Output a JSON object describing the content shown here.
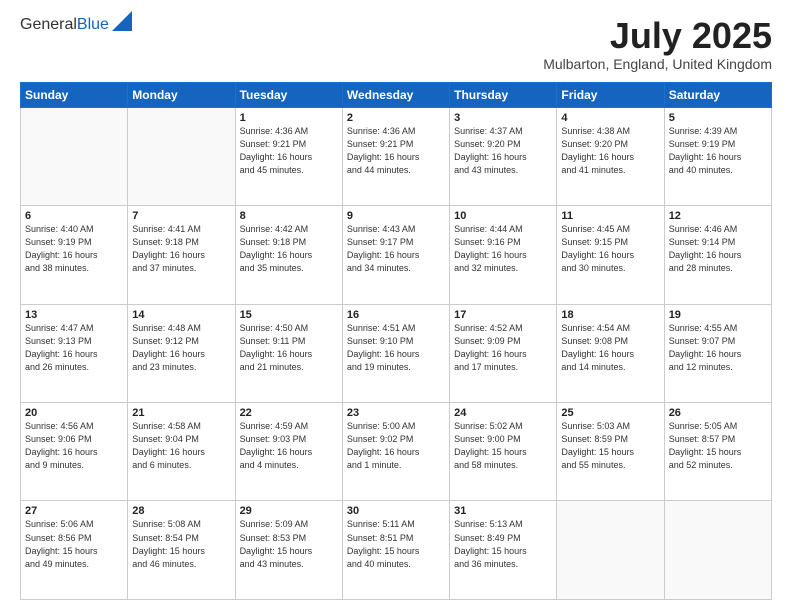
{
  "logo": {
    "general": "General",
    "blue": "Blue"
  },
  "header": {
    "title": "July 2025",
    "location": "Mulbarton, England, United Kingdom"
  },
  "days_of_week": [
    "Sunday",
    "Monday",
    "Tuesday",
    "Wednesday",
    "Thursday",
    "Friday",
    "Saturday"
  ],
  "weeks": [
    [
      {
        "day": "",
        "info": ""
      },
      {
        "day": "",
        "info": ""
      },
      {
        "day": "1",
        "info": "Sunrise: 4:36 AM\nSunset: 9:21 PM\nDaylight: 16 hours\nand 45 minutes."
      },
      {
        "day": "2",
        "info": "Sunrise: 4:36 AM\nSunset: 9:21 PM\nDaylight: 16 hours\nand 44 minutes."
      },
      {
        "day": "3",
        "info": "Sunrise: 4:37 AM\nSunset: 9:20 PM\nDaylight: 16 hours\nand 43 minutes."
      },
      {
        "day": "4",
        "info": "Sunrise: 4:38 AM\nSunset: 9:20 PM\nDaylight: 16 hours\nand 41 minutes."
      },
      {
        "day": "5",
        "info": "Sunrise: 4:39 AM\nSunset: 9:19 PM\nDaylight: 16 hours\nand 40 minutes."
      }
    ],
    [
      {
        "day": "6",
        "info": "Sunrise: 4:40 AM\nSunset: 9:19 PM\nDaylight: 16 hours\nand 38 minutes."
      },
      {
        "day": "7",
        "info": "Sunrise: 4:41 AM\nSunset: 9:18 PM\nDaylight: 16 hours\nand 37 minutes."
      },
      {
        "day": "8",
        "info": "Sunrise: 4:42 AM\nSunset: 9:18 PM\nDaylight: 16 hours\nand 35 minutes."
      },
      {
        "day": "9",
        "info": "Sunrise: 4:43 AM\nSunset: 9:17 PM\nDaylight: 16 hours\nand 34 minutes."
      },
      {
        "day": "10",
        "info": "Sunrise: 4:44 AM\nSunset: 9:16 PM\nDaylight: 16 hours\nand 32 minutes."
      },
      {
        "day": "11",
        "info": "Sunrise: 4:45 AM\nSunset: 9:15 PM\nDaylight: 16 hours\nand 30 minutes."
      },
      {
        "day": "12",
        "info": "Sunrise: 4:46 AM\nSunset: 9:14 PM\nDaylight: 16 hours\nand 28 minutes."
      }
    ],
    [
      {
        "day": "13",
        "info": "Sunrise: 4:47 AM\nSunset: 9:13 PM\nDaylight: 16 hours\nand 26 minutes."
      },
      {
        "day": "14",
        "info": "Sunrise: 4:48 AM\nSunset: 9:12 PM\nDaylight: 16 hours\nand 23 minutes."
      },
      {
        "day": "15",
        "info": "Sunrise: 4:50 AM\nSunset: 9:11 PM\nDaylight: 16 hours\nand 21 minutes."
      },
      {
        "day": "16",
        "info": "Sunrise: 4:51 AM\nSunset: 9:10 PM\nDaylight: 16 hours\nand 19 minutes."
      },
      {
        "day": "17",
        "info": "Sunrise: 4:52 AM\nSunset: 9:09 PM\nDaylight: 16 hours\nand 17 minutes."
      },
      {
        "day": "18",
        "info": "Sunrise: 4:54 AM\nSunset: 9:08 PM\nDaylight: 16 hours\nand 14 minutes."
      },
      {
        "day": "19",
        "info": "Sunrise: 4:55 AM\nSunset: 9:07 PM\nDaylight: 16 hours\nand 12 minutes."
      }
    ],
    [
      {
        "day": "20",
        "info": "Sunrise: 4:56 AM\nSunset: 9:06 PM\nDaylight: 16 hours\nand 9 minutes."
      },
      {
        "day": "21",
        "info": "Sunrise: 4:58 AM\nSunset: 9:04 PM\nDaylight: 16 hours\nand 6 minutes."
      },
      {
        "day": "22",
        "info": "Sunrise: 4:59 AM\nSunset: 9:03 PM\nDaylight: 16 hours\nand 4 minutes."
      },
      {
        "day": "23",
        "info": "Sunrise: 5:00 AM\nSunset: 9:02 PM\nDaylight: 16 hours\nand 1 minute."
      },
      {
        "day": "24",
        "info": "Sunrise: 5:02 AM\nSunset: 9:00 PM\nDaylight: 15 hours\nand 58 minutes."
      },
      {
        "day": "25",
        "info": "Sunrise: 5:03 AM\nSunset: 8:59 PM\nDaylight: 15 hours\nand 55 minutes."
      },
      {
        "day": "26",
        "info": "Sunrise: 5:05 AM\nSunset: 8:57 PM\nDaylight: 15 hours\nand 52 minutes."
      }
    ],
    [
      {
        "day": "27",
        "info": "Sunrise: 5:06 AM\nSunset: 8:56 PM\nDaylight: 15 hours\nand 49 minutes."
      },
      {
        "day": "28",
        "info": "Sunrise: 5:08 AM\nSunset: 8:54 PM\nDaylight: 15 hours\nand 46 minutes."
      },
      {
        "day": "29",
        "info": "Sunrise: 5:09 AM\nSunset: 8:53 PM\nDaylight: 15 hours\nand 43 minutes."
      },
      {
        "day": "30",
        "info": "Sunrise: 5:11 AM\nSunset: 8:51 PM\nDaylight: 15 hours\nand 40 minutes."
      },
      {
        "day": "31",
        "info": "Sunrise: 5:13 AM\nSunset: 8:49 PM\nDaylight: 15 hours\nand 36 minutes."
      },
      {
        "day": "",
        "info": ""
      },
      {
        "day": "",
        "info": ""
      }
    ]
  ]
}
